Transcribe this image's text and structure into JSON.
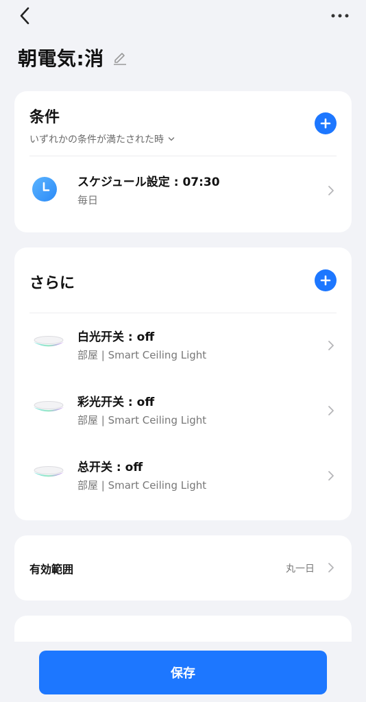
{
  "header": {
    "title": "朝電気:消"
  },
  "conditions": {
    "heading": "条件",
    "match_mode": "いずれかの条件が満たされた時",
    "items": [
      {
        "title": "スケジュール設定 : 07:30",
        "subtitle": "毎日",
        "icon": "clock-icon"
      }
    ]
  },
  "actions": {
    "heading": "さらに",
    "items": [
      {
        "title": "白光开关 : off",
        "subtitle": "部屋 | Smart Ceiling Light",
        "icon": "ceiling-light-icon"
      },
      {
        "title": "彩光开关 : off",
        "subtitle": "部屋 | Smart Ceiling Light",
        "icon": "ceiling-light-icon"
      },
      {
        "title": "总开关 : off",
        "subtitle": "部屋 | Smart Ceiling Light",
        "icon": "ceiling-light-icon"
      }
    ]
  },
  "validity": {
    "label": "有効範囲",
    "value": "丸一日"
  },
  "footer": {
    "save_label": "保存"
  },
  "colors": {
    "accent": "#1d77ff",
    "background": "#f2f3f7",
    "card": "#ffffff"
  }
}
